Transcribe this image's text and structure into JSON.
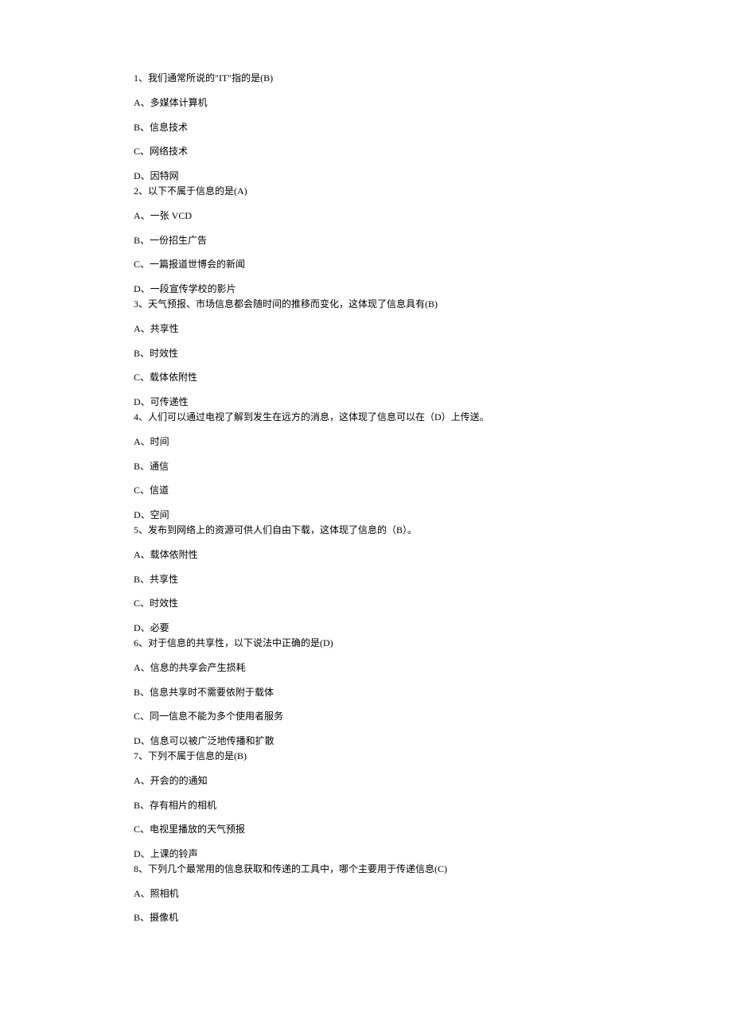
{
  "questions": [
    {
      "text": "1、我们通常所说的\"IT\"指的是(B)",
      "options": [
        "A、多媒体计算机",
        "B、信息技术",
        "C、网络技术",
        "D、因特网"
      ]
    },
    {
      "text": "2、以下不属于信息的是(A)",
      "options": [
        "A、一张 VCD",
        "B、一份招生广告",
        "C、一篇报道世博会的新闻",
        "D、一段宣传学校的影片"
      ]
    },
    {
      "text": "3、天气预报、市场信息都会随时间的推移而变化，这体现了信息具有(B)",
      "options": [
        "A、共享性",
        "B、时效性",
        "C、载体依附性",
        "D、可传递性"
      ]
    },
    {
      "text": "4、人们可以通过电视了解到发生在远方的消息，这体现了信息可以在（D）上传送。",
      "options": [
        "A、时间",
        "B、通信",
        "C、信道",
        "D、空间"
      ]
    },
    {
      "text": "5、发布到网络上的资源可供人们自由下载，这体现了信息的（B）。",
      "options": [
        "A、载体依附性",
        "B、共享性",
        "C、时效性",
        "D、必要"
      ]
    },
    {
      "text": "6、对于信息的共享性，以下说法中正确的是(D)",
      "options": [
        "A、信息的共享会产生损耗",
        "B、信息共享时不需要依附于载体",
        "C、同一信息不能为多个使用者服务",
        "D、信息可以被广泛地传播和扩散"
      ]
    },
    {
      "text": "7、下列不属于信息的是(B)",
      "options": [
        "A、开会的的通知",
        "B、存有相片的相机",
        "C、电视里播放的天气预报",
        "D、上课的铃声"
      ]
    },
    {
      "text": "8、下列几个最常用的信息获取和传递的工具中，哪个主要用于传递信息(C)",
      "options": [
        "A、照相机",
        "B、摄像机"
      ]
    }
  ]
}
